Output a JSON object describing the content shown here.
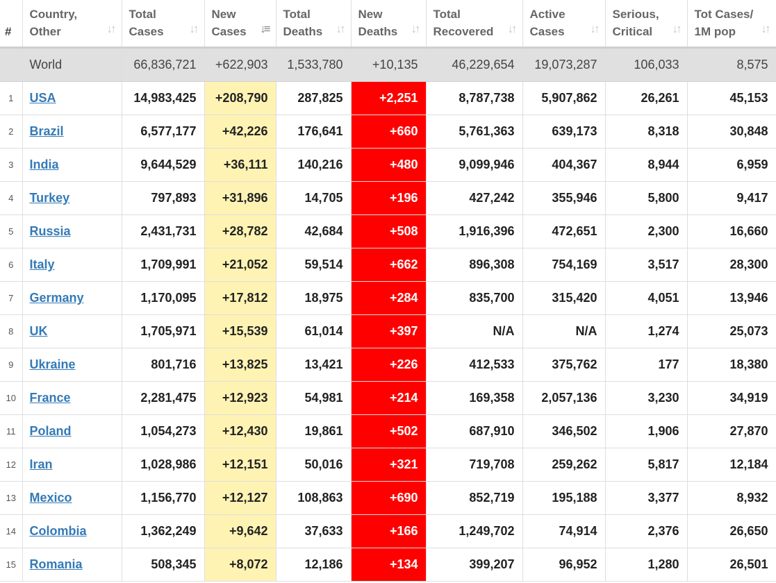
{
  "columns": [
    {
      "label": "#",
      "sortable": false
    },
    {
      "label": "Country,\nOther",
      "sortable": true
    },
    {
      "label": "Total\nCases",
      "sortable": true
    },
    {
      "label": "New\nCases",
      "sortable": true,
      "active_sort": true
    },
    {
      "label": "Total\nDeaths",
      "sortable": true
    },
    {
      "label": "New\nDeaths",
      "sortable": true
    },
    {
      "label": "Total\nRecovered",
      "sortable": true
    },
    {
      "label": "Active\nCases",
      "sortable": true
    },
    {
      "label": "Serious,\nCritical",
      "sortable": true
    },
    {
      "label": "Tot Cases/\n1M pop",
      "sortable": true
    }
  ],
  "colors": {
    "new_cases_bg": "#fff3b3",
    "new_deaths_bg": "#ff0000",
    "world_row_bg": "#e0e0e0",
    "link": "#337ab7"
  },
  "world": {
    "country": "World",
    "total_cases": "66,836,721",
    "new_cases": "+622,903",
    "total_deaths": "1,533,780",
    "new_deaths": "+10,135",
    "total_recovered": "46,229,654",
    "active_cases": "19,073,287",
    "serious_critical": "106,033",
    "cases_per_1m": "8,575"
  },
  "rows": [
    {
      "rank": "1",
      "country": "USA",
      "total_cases": "14,983,425",
      "new_cases": "+208,790",
      "total_deaths": "287,825",
      "new_deaths": "+2,251",
      "total_recovered": "8,787,738",
      "active_cases": "5,907,862",
      "serious_critical": "26,261",
      "cases_per_1m": "45,153"
    },
    {
      "rank": "2",
      "country": "Brazil",
      "total_cases": "6,577,177",
      "new_cases": "+42,226",
      "total_deaths": "176,641",
      "new_deaths": "+660",
      "total_recovered": "5,761,363",
      "active_cases": "639,173",
      "serious_critical": "8,318",
      "cases_per_1m": "30,848"
    },
    {
      "rank": "3",
      "country": "India",
      "total_cases": "9,644,529",
      "new_cases": "+36,111",
      "total_deaths": "140,216",
      "new_deaths": "+480",
      "total_recovered": "9,099,946",
      "active_cases": "404,367",
      "serious_critical": "8,944",
      "cases_per_1m": "6,959"
    },
    {
      "rank": "4",
      "country": "Turkey",
      "total_cases": "797,893",
      "new_cases": "+31,896",
      "total_deaths": "14,705",
      "new_deaths": "+196",
      "total_recovered": "427,242",
      "active_cases": "355,946",
      "serious_critical": "5,800",
      "cases_per_1m": "9,417"
    },
    {
      "rank": "5",
      "country": "Russia",
      "total_cases": "2,431,731",
      "new_cases": "+28,782",
      "total_deaths": "42,684",
      "new_deaths": "+508",
      "total_recovered": "1,916,396",
      "active_cases": "472,651",
      "serious_critical": "2,300",
      "cases_per_1m": "16,660"
    },
    {
      "rank": "6",
      "country": "Italy",
      "total_cases": "1,709,991",
      "new_cases": "+21,052",
      "total_deaths": "59,514",
      "new_deaths": "+662",
      "total_recovered": "896,308",
      "active_cases": "754,169",
      "serious_critical": "3,517",
      "cases_per_1m": "28,300"
    },
    {
      "rank": "7",
      "country": "Germany",
      "total_cases": "1,170,095",
      "new_cases": "+17,812",
      "total_deaths": "18,975",
      "new_deaths": "+284",
      "total_recovered": "835,700",
      "active_cases": "315,420",
      "serious_critical": "4,051",
      "cases_per_1m": "13,946"
    },
    {
      "rank": "8",
      "country": "UK",
      "total_cases": "1,705,971",
      "new_cases": "+15,539",
      "total_deaths": "61,014",
      "new_deaths": "+397",
      "total_recovered": "N/A",
      "active_cases": "N/A",
      "serious_critical": "1,274",
      "cases_per_1m": "25,073"
    },
    {
      "rank": "9",
      "country": "Ukraine",
      "total_cases": "801,716",
      "new_cases": "+13,825",
      "total_deaths": "13,421",
      "new_deaths": "+226",
      "total_recovered": "412,533",
      "active_cases": "375,762",
      "serious_critical": "177",
      "cases_per_1m": "18,380"
    },
    {
      "rank": "10",
      "country": "France",
      "total_cases": "2,281,475",
      "new_cases": "+12,923",
      "total_deaths": "54,981",
      "new_deaths": "+214",
      "total_recovered": "169,358",
      "active_cases": "2,057,136",
      "serious_critical": "3,230",
      "cases_per_1m": "34,919"
    },
    {
      "rank": "11",
      "country": "Poland",
      "total_cases": "1,054,273",
      "new_cases": "+12,430",
      "total_deaths": "19,861",
      "new_deaths": "+502",
      "total_recovered": "687,910",
      "active_cases": "346,502",
      "serious_critical": "1,906",
      "cases_per_1m": "27,870"
    },
    {
      "rank": "12",
      "country": "Iran",
      "total_cases": "1,028,986",
      "new_cases": "+12,151",
      "total_deaths": "50,016",
      "new_deaths": "+321",
      "total_recovered": "719,708",
      "active_cases": "259,262",
      "serious_critical": "5,817",
      "cases_per_1m": "12,184"
    },
    {
      "rank": "13",
      "country": "Mexico",
      "total_cases": "1,156,770",
      "new_cases": "+12,127",
      "total_deaths": "108,863",
      "new_deaths": "+690",
      "total_recovered": "852,719",
      "active_cases": "195,188",
      "serious_critical": "3,377",
      "cases_per_1m": "8,932"
    },
    {
      "rank": "14",
      "country": "Colombia",
      "total_cases": "1,362,249",
      "new_cases": "+9,642",
      "total_deaths": "37,633",
      "new_deaths": "+166",
      "total_recovered": "1,249,702",
      "active_cases": "74,914",
      "serious_critical": "2,376",
      "cases_per_1m": "26,650"
    },
    {
      "rank": "15",
      "country": "Romania",
      "total_cases": "508,345",
      "new_cases": "+8,072",
      "total_deaths": "12,186",
      "new_deaths": "+134",
      "total_recovered": "399,207",
      "active_cases": "96,952",
      "serious_critical": "1,280",
      "cases_per_1m": "26,501"
    }
  ]
}
